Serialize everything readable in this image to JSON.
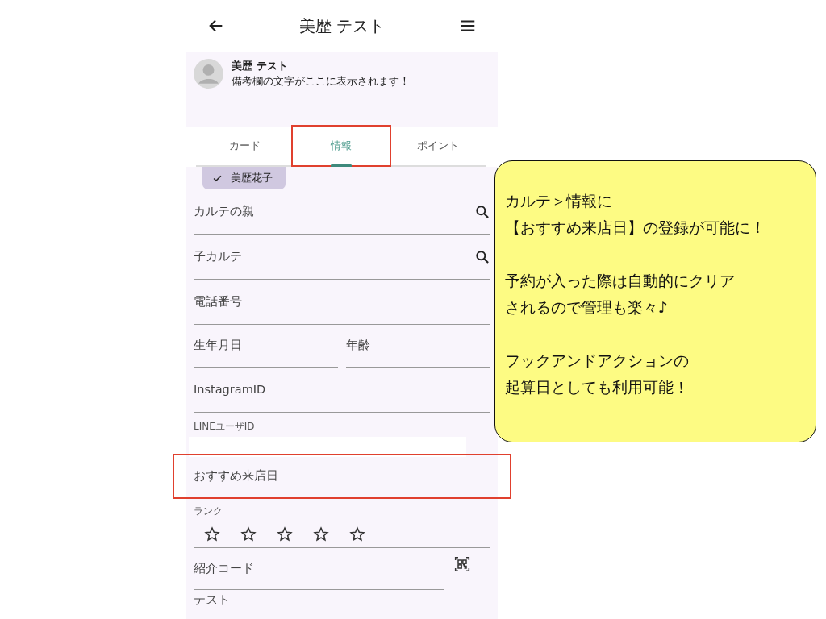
{
  "app_bar": {
    "title": "美歴 テスト"
  },
  "profile": {
    "name": "美歴 テスト",
    "note": "備考欄の文字がここに表示されます！"
  },
  "tabs": [
    {
      "label": "カード",
      "selected": false,
      "highlighted": false
    },
    {
      "label": "情報",
      "selected": true,
      "highlighted": true
    },
    {
      "label": "ポイント",
      "selected": false,
      "highlighted": false
    }
  ],
  "chip": {
    "label": "美歴花子",
    "selected": true
  },
  "fields": [
    {
      "kind": "search",
      "label": "カルテの親",
      "highlighted": false
    },
    {
      "kind": "search",
      "label": "子カルテ",
      "highlighted": false
    },
    {
      "kind": "text",
      "label": "電話番号",
      "highlighted": false
    },
    {
      "kind": "pair",
      "label": "生年月日",
      "label_2": "年齢",
      "highlighted": false
    },
    {
      "kind": "text",
      "label": "InstagramID",
      "highlighted": false
    },
    {
      "kind": "filled",
      "label": "LINEユーザID",
      "highlighted": false
    },
    {
      "kind": "plain",
      "label": "おすすめ来店日",
      "highlighted": true
    },
    {
      "kind": "stars",
      "label": "ランク",
      "stars": 0,
      "highlighted": false
    },
    {
      "kind": "qr",
      "label": "紹介コード",
      "highlighted": false
    },
    {
      "kind": "text",
      "label": "テスト",
      "highlighted": false
    }
  ],
  "callout": {
    "paragraphs": [
      [
        "カルテ＞情報に",
        "【おすすめ来店日】の登録が可能に！"
      ],
      [
        "予約が入った際は自動的にクリア",
        "されるので管理も楽々♪"
      ],
      [
        "フックアンドアクションの",
        "起算日としても利用可能！"
      ]
    ]
  }
}
